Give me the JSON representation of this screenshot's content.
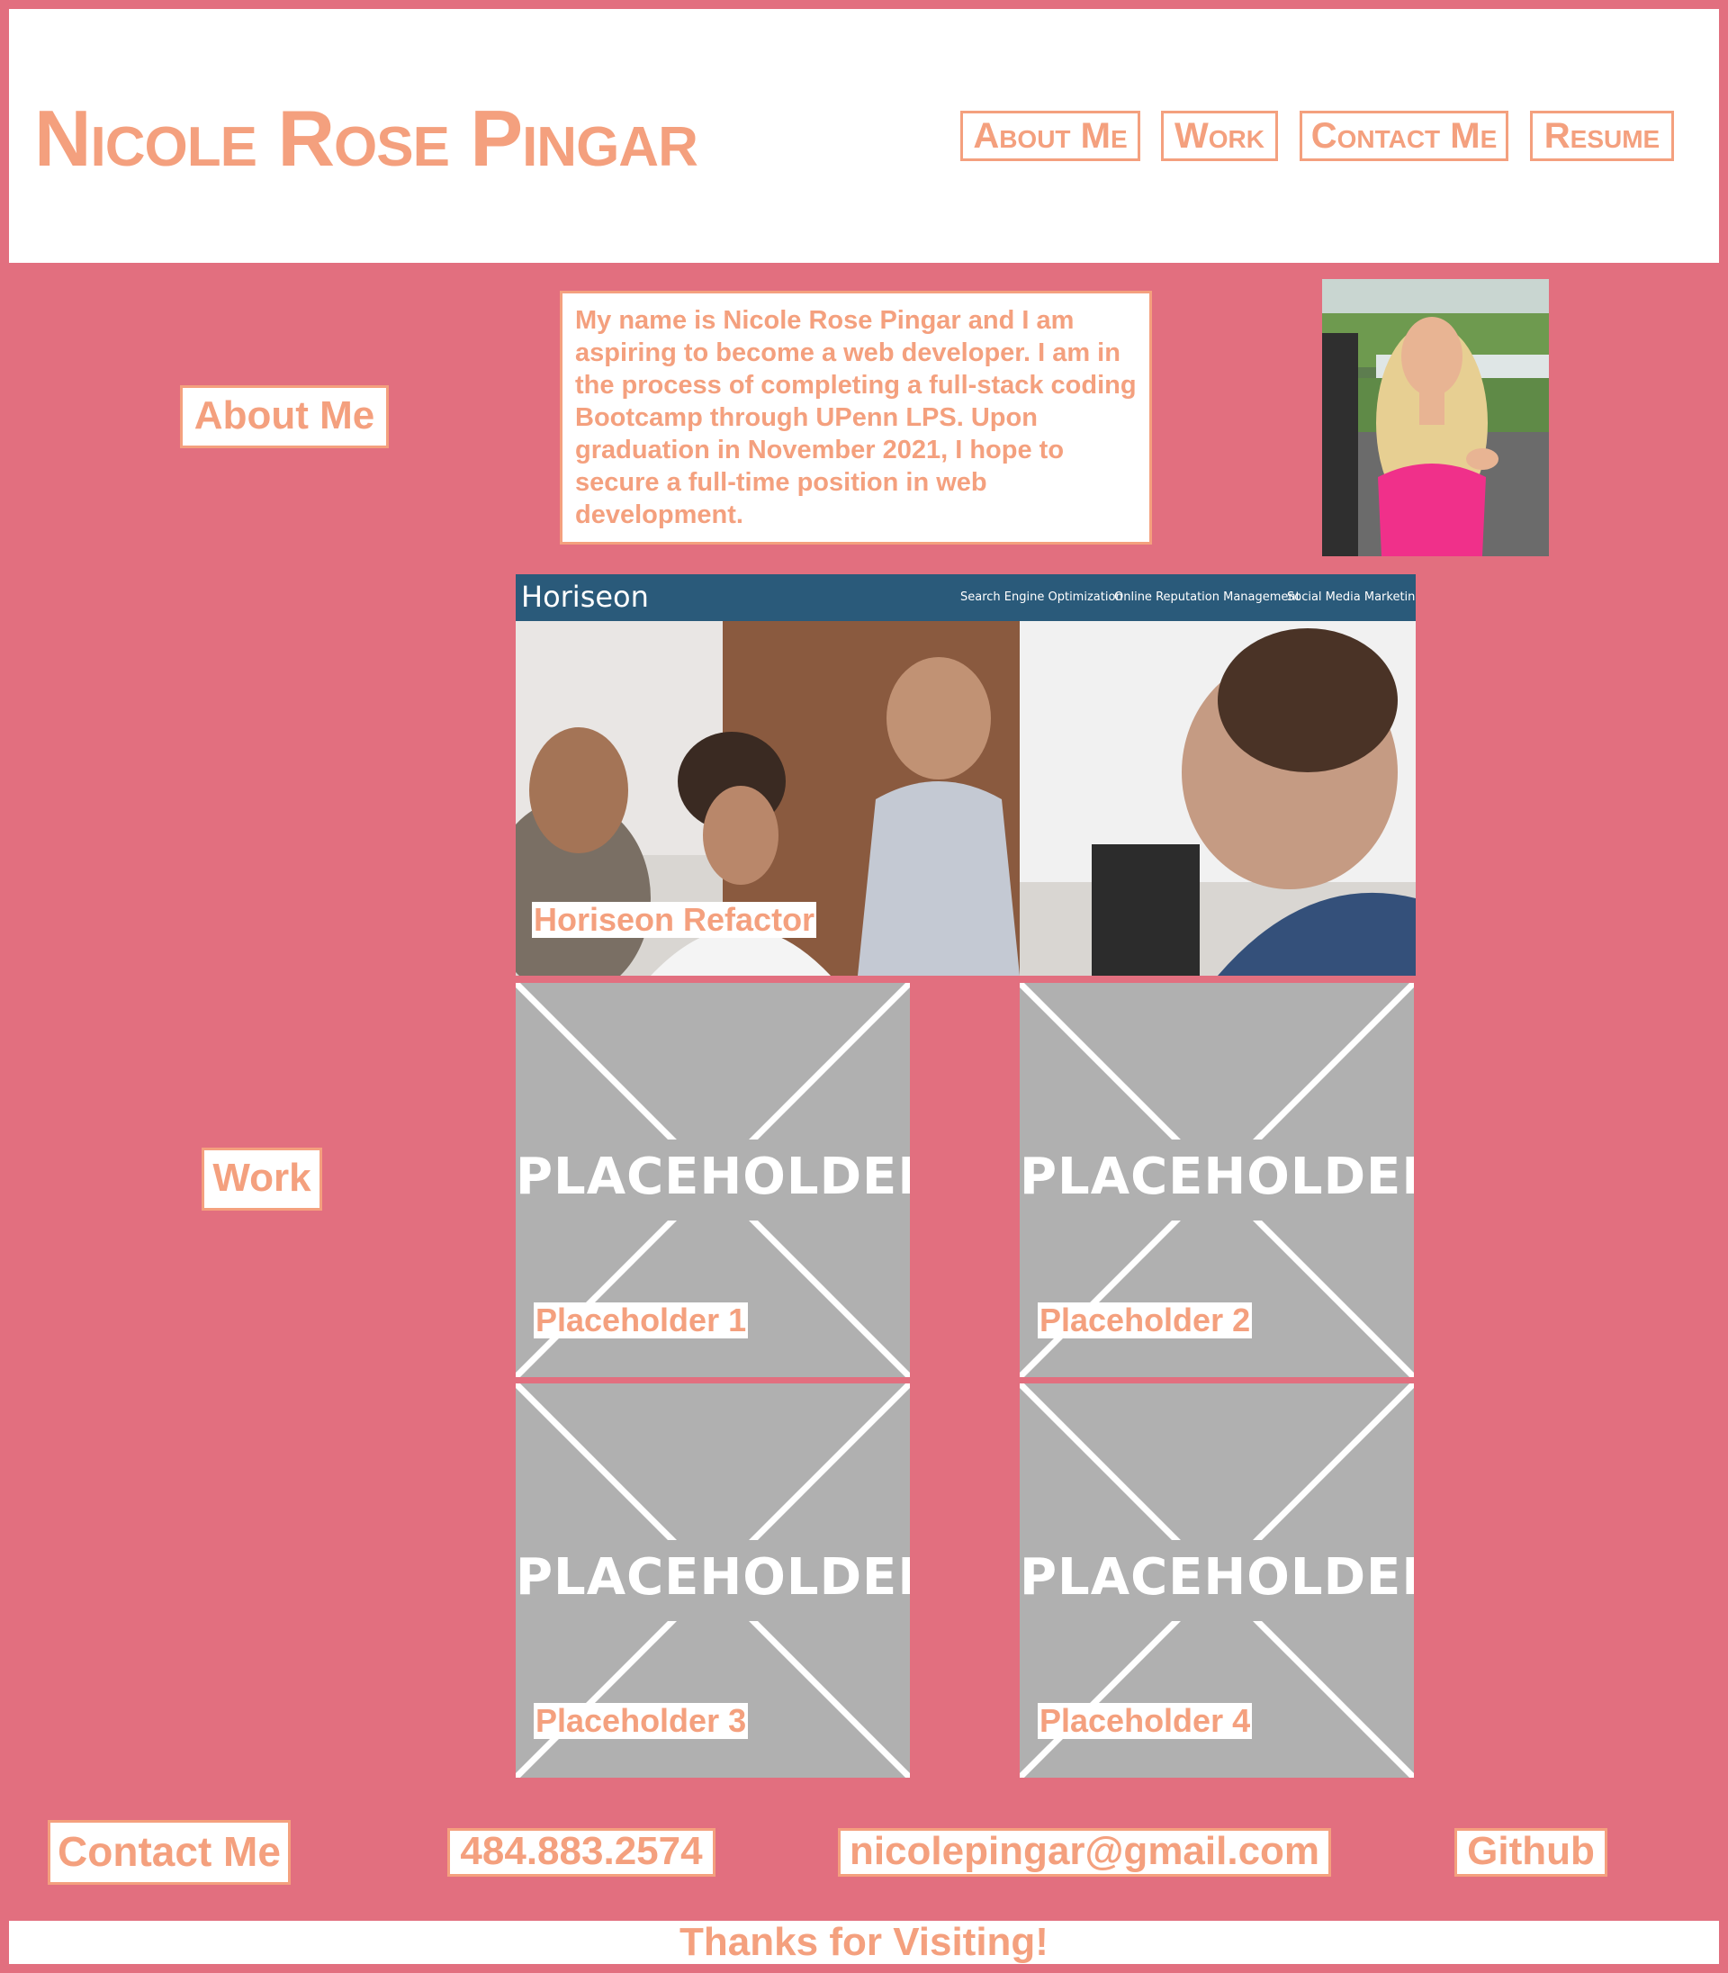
{
  "header": {
    "title": "Nicole Rose Pingar",
    "nav": [
      "About Me",
      "Work",
      "Contact Me",
      "Resume"
    ]
  },
  "about": {
    "heading": "About Me",
    "text": "My name is Nicole Rose Pingar and I am aspiring to become a web developer. I am in the process of completing a full-stack coding Bootcamp through UPenn LPS. Upon graduation in November 2021, I hope to secure a full-time position in web development."
  },
  "work": {
    "heading": "Work",
    "featured": {
      "title": "Horiseon Refactor",
      "site_logo": "Horiseon",
      "site_nav": [
        "Search Engine Optimization",
        "Online Reputation Management",
        "Social Media Marketing"
      ]
    },
    "placeholder_word": "PLACEHOLDER",
    "projects": [
      "Placeholder 1",
      "Placeholder 2",
      "Placeholder 3",
      "Placeholder 4"
    ]
  },
  "contact": {
    "heading": "Contact Me",
    "phone": "484.883.2574",
    "email": "nicolepingar@gmail.com",
    "github": "Github"
  },
  "footer": {
    "text": "Thanks for Visiting!"
  },
  "colors": {
    "background": "#e26f7f",
    "accent": "#f4a07e",
    "panel": "#ffffff",
    "placeholder": "#b0b0b0"
  }
}
